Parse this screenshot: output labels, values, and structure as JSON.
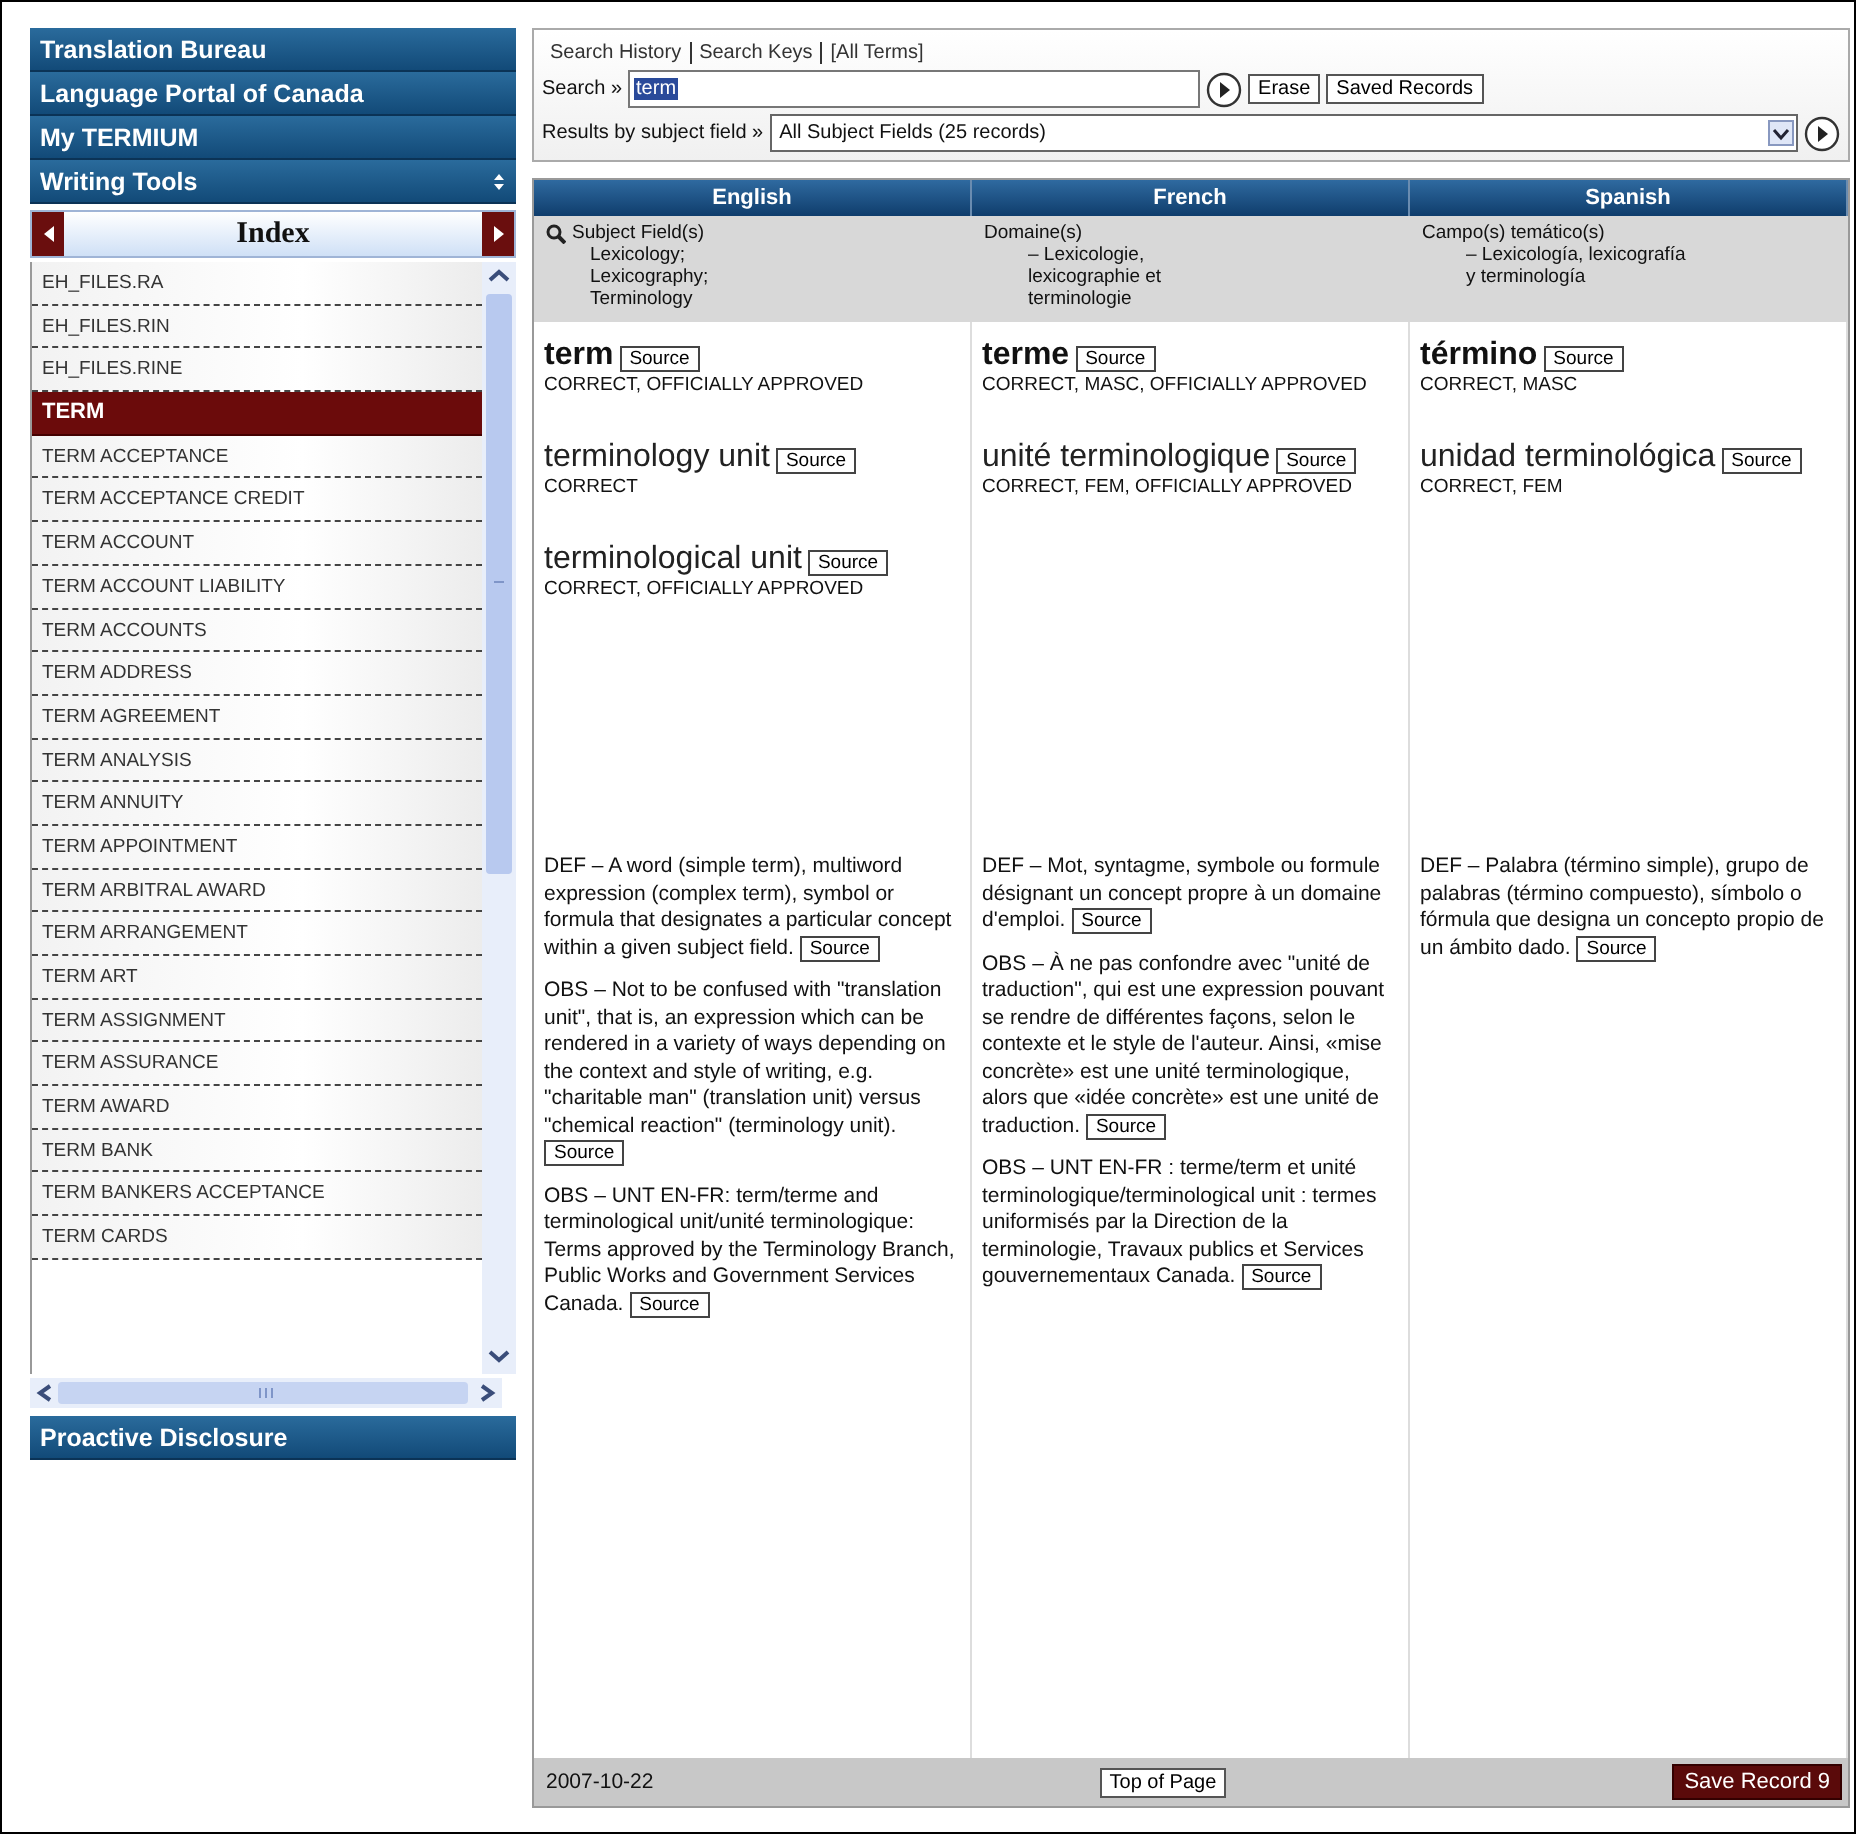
{
  "sidebar": {
    "nav": [
      {
        "label": "Translation Bureau"
      },
      {
        "label": "Language Portal of Canada"
      },
      {
        "label": "My TERMIUM"
      },
      {
        "label": "Writing Tools"
      }
    ],
    "index_title": "Index",
    "items": [
      {
        "label": "EH_FILES.RA",
        "selected": false
      },
      {
        "label": "EH_FILES.RIN",
        "selected": false
      },
      {
        "label": "EH_FILES.RINE",
        "selected": false
      },
      {
        "label": "TERM",
        "selected": true
      },
      {
        "label": "TERM ACCEPTANCE",
        "selected": false
      },
      {
        "label": "TERM ACCEPTANCE CREDIT",
        "selected": false
      },
      {
        "label": "TERM ACCOUNT",
        "selected": false
      },
      {
        "label": "TERM ACCOUNT LIABILITY",
        "selected": false
      },
      {
        "label": "TERM ACCOUNTS",
        "selected": false
      },
      {
        "label": "TERM ADDRESS",
        "selected": false
      },
      {
        "label": "TERM AGREEMENT",
        "selected": false
      },
      {
        "label": "TERM ANALYSIS",
        "selected": false
      },
      {
        "label": "TERM ANNUITY",
        "selected": false
      },
      {
        "label": "TERM APPOINTMENT",
        "selected": false
      },
      {
        "label": "TERM ARBITRAL AWARD",
        "selected": false
      },
      {
        "label": "TERM ARRANGEMENT",
        "selected": false
      },
      {
        "label": "TERM ART",
        "selected": false
      },
      {
        "label": "TERM ASSIGNMENT",
        "selected": false
      },
      {
        "label": "TERM ASSURANCE",
        "selected": false
      },
      {
        "label": "TERM AWARD",
        "selected": false
      },
      {
        "label": "TERM BANK",
        "selected": false
      },
      {
        "label": "TERM BANKERS ACCEPTANCE",
        "selected": false
      },
      {
        "label": "TERM CARDS",
        "selected": false
      }
    ],
    "footer_nav": [
      {
        "label": "Proactive Disclosure"
      }
    ]
  },
  "search": {
    "tabs": [
      {
        "label": "Search History"
      },
      {
        "label": "Search Keys"
      },
      {
        "label": "[All Terms]"
      }
    ],
    "label": "Search »",
    "value": "term",
    "buttons": [
      "Erase",
      "Saved Records"
    ],
    "filter_label": "Results by subject field »",
    "filter_value": "All Subject Fields (25 records)"
  },
  "record": {
    "columns": [
      {
        "heading": "English",
        "subject_label": "Subject Field(s)",
        "subjects": [
          "Lexicology;",
          "Lexicography;",
          "Terminology"
        ],
        "terms": [
          {
            "kind": "main",
            "text": "term",
            "source": "Source",
            "status": "CORRECT, OFFICIALLY APPROVED"
          },
          {
            "kind": "synonym",
            "text": "terminology unit",
            "source": "Source",
            "status": "CORRECT"
          },
          {
            "kind": "synonym",
            "text": "terminological unit",
            "source": "Source",
            "status": "CORRECT, OFFICIALLY APPROVED"
          }
        ],
        "notes": [
          {
            "text": "DEF – A word (simple term), multiword expression (complex term), symbol or formula that designates a particular concept within a given subject field.",
            "source": "Source"
          },
          {
            "text": "OBS – Not to be confused with \"translation unit\", that is, an expression which can be rendered in a variety of ways depending on the context and style of writing, e.g. \"charitable man\" (translation unit) versus \"chemical reaction\" (terminology unit).",
            "source": "Source"
          },
          {
            "text": "OBS – UNT EN-FR: term/terme and terminological unit/unité terminologique: Terms approved by the Terminology Branch, Public Works and Government Services Canada.",
            "source": "Source"
          }
        ]
      },
      {
        "heading": "French",
        "subject_label": "Domaine(s)",
        "subjects": [
          "– Lexicologie,",
          "lexicographie et",
          "terminologie"
        ],
        "terms": [
          {
            "kind": "main",
            "text": "terme",
            "source": "Source",
            "status": "CORRECT, MASC, OFFICIALLY APPROVED"
          },
          {
            "kind": "synonym",
            "text": "unité terminologique",
            "source": "Source",
            "status": "CORRECT, FEM, OFFICIALLY APPROVED"
          }
        ],
        "notes": [
          {
            "text": "DEF – Mot, syntagme, symbole ou formule désignant un concept propre à un domaine d'emploi.",
            "source": "Source"
          },
          {
            "text": "OBS – À ne pas confondre avec \"unité de traduction\", qui est une expression pouvant se rendre de différentes façons, selon le contexte et le style de l'auteur. Ainsi, «mise concrète» est une unité terminologique, alors que «idée concrète» est une unité de traduction.",
            "source": "Source"
          },
          {
            "text": "OBS – UNT EN-FR : terme/term et unité terminologique/terminological unit : termes uniformisés par la Direction de la terminologie, Travaux publics et Services gouvernementaux Canada.",
            "source": "Source"
          }
        ]
      },
      {
        "heading": "Spanish",
        "subject_label": "Campo(s) temático(s)",
        "subjects": [
          "– Lexicología, lexicografía",
          "y terminología"
        ],
        "terms": [
          {
            "kind": "main",
            "text": "término",
            "source": "Source",
            "status": "CORRECT, MASC"
          },
          {
            "kind": "synonym",
            "text": "unidad terminológica",
            "source": "Source",
            "status": "CORRECT, FEM"
          }
        ],
        "notes": [
          {
            "text": "DEF – Palabra (término simple), grupo de palabras (término compuesto), símbolo o fórmula que designa un concepto propio de un ámbito dado.",
            "source": "Source"
          }
        ]
      }
    ],
    "date": "2007-10-22",
    "top_button": "Top of Page",
    "save_button": "Save Record 9"
  }
}
